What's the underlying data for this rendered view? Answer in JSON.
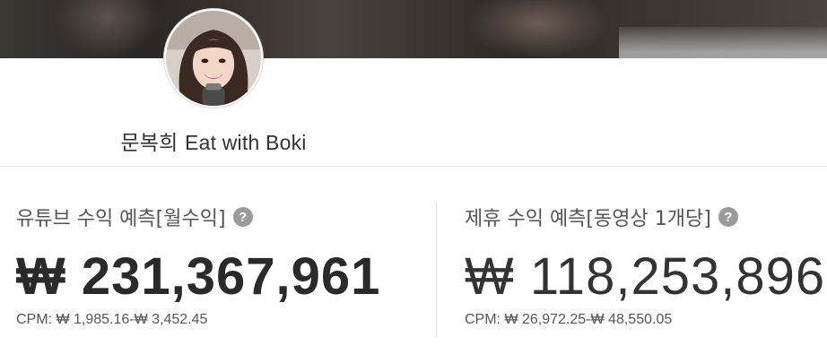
{
  "channel": {
    "name_ko": "문복희",
    "name_en": "Eat with Boki"
  },
  "youtube_estimate": {
    "title": "유튜브 수익 예측[월수익]",
    "amount": "₩ 231,367,961",
    "cpm_label": "CPM:",
    "cpm_range": "₩ 1,985.16-₩ 3,452.45"
  },
  "sponsorship_estimate": {
    "title": "제휴 수익 예측[동영상 1개당]",
    "amount": "₩ 118,253,896",
    "cpm_label": "CPM:",
    "cpm_range": "₩ 26,972.25-₩ 48,550.05"
  },
  "icons": {
    "help": "help-icon"
  },
  "colors": {
    "help_icon": "#9a9a9a",
    "amount_text": "#2a2a2a"
  }
}
